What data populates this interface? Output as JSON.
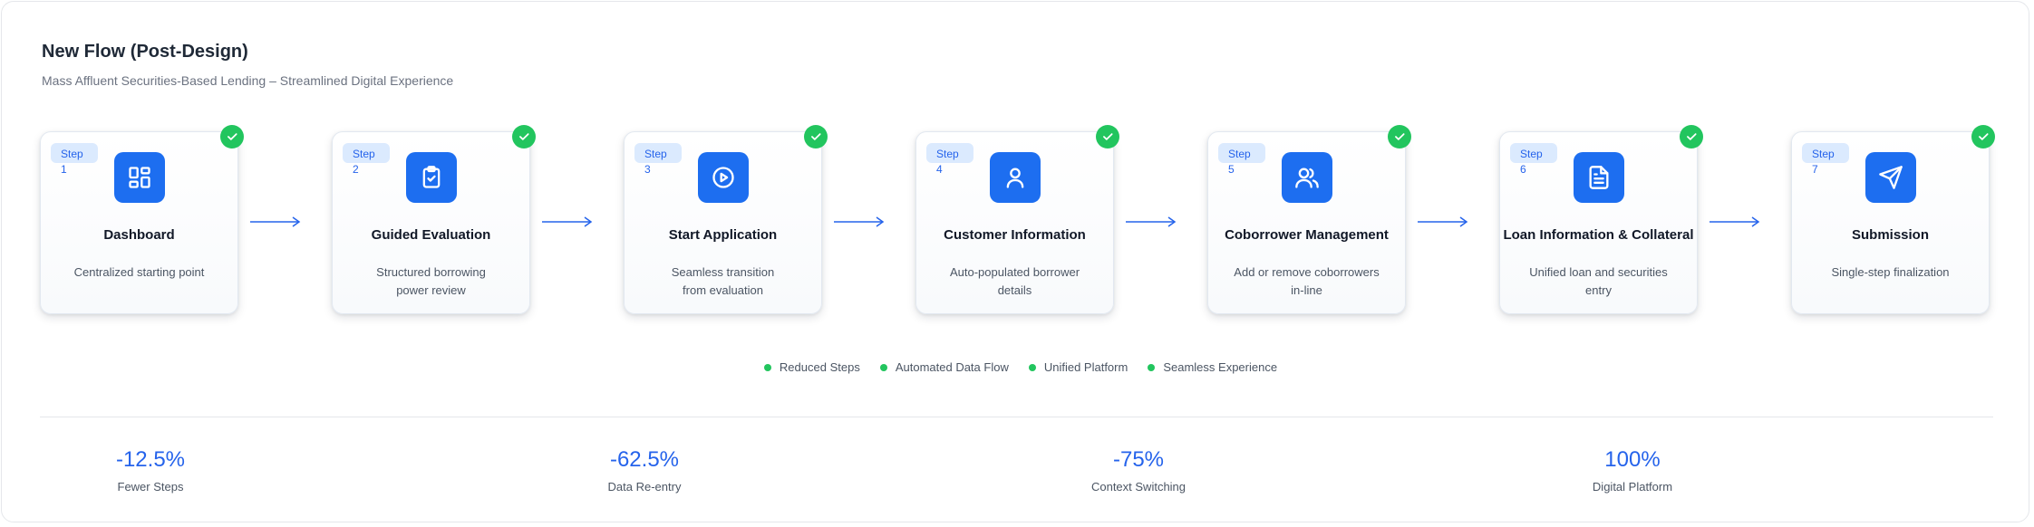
{
  "header": {
    "title": "New Flow (Post-Design)",
    "subtitle": "Mass Affluent Securities-Based Lending – Streamlined Digital Experience"
  },
  "colors": {
    "accent": "#1d6ef0",
    "accent_text": "#2563eb",
    "badge_bg": "#dbeafe",
    "success": "#22c55e"
  },
  "steps": [
    {
      "step_label": "Step",
      "number": "1",
      "icon": "dashboard-grid-icon",
      "title": "Dashboard",
      "desc_line1": "Centralized starting point",
      "desc_line2": ""
    },
    {
      "step_label": "Step",
      "number": "2",
      "icon": "clipboard-check-icon",
      "title": "Guided Evaluation",
      "desc_line1": "Structured borrowing",
      "desc_line2": "power review"
    },
    {
      "step_label": "Step",
      "number": "3",
      "icon": "play-circle-icon",
      "title": "Start Application",
      "desc_line1": "Seamless transition",
      "desc_line2": "from evaluation"
    },
    {
      "step_label": "Step",
      "number": "4",
      "icon": "user-icon",
      "title": "Customer Information",
      "desc_line1": "Auto-populated borrower details",
      "desc_line2": ""
    },
    {
      "step_label": "Step",
      "number": "5",
      "icon": "users-icon",
      "title": "Coborrower Management",
      "desc_line1": "Add or remove coborrowers in-line",
      "desc_line2": ""
    },
    {
      "step_label": "Step",
      "number": "6",
      "icon": "document-icon",
      "title": "Loan Information & Collateral",
      "desc_line1": "Unified loan and securities entry",
      "desc_line2": ""
    },
    {
      "step_label": "Step",
      "number": "7",
      "icon": "send-icon",
      "title": "Submission",
      "desc_line1": "Single-step finalization",
      "desc_line2": ""
    }
  ],
  "legend": [
    {
      "label": "Reduced Steps"
    },
    {
      "label": "Automated Data Flow"
    },
    {
      "label": "Unified Platform"
    },
    {
      "label": "Seamless Experience"
    }
  ],
  "metrics": [
    {
      "value": "-12.5%",
      "label": "Fewer Steps"
    },
    {
      "value": "-62.5%",
      "label": "Data Re-entry"
    },
    {
      "value": "-75%",
      "label": "Context Switching"
    },
    {
      "value": "100%",
      "label": "Digital Platform"
    }
  ]
}
